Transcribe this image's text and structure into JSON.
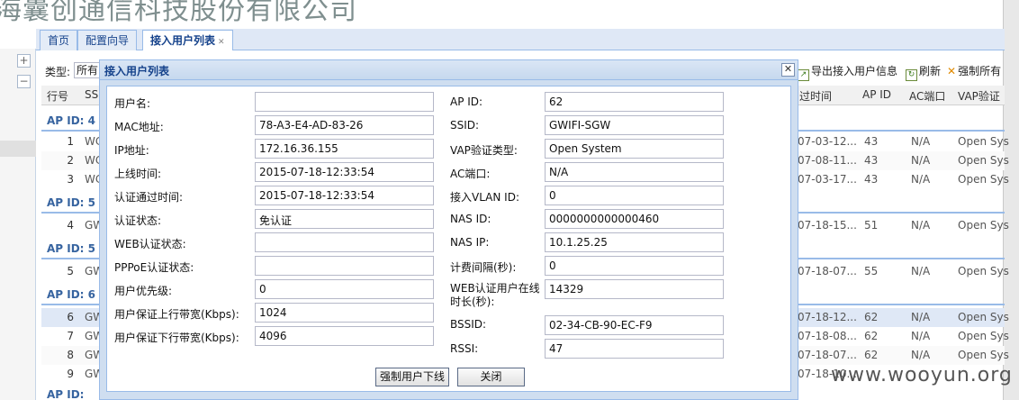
{
  "app_title": "海囊创通信科技股份有限公司",
  "tabs": [
    {
      "label": "首页"
    },
    {
      "label": "配置向导"
    },
    {
      "label": "接入用户列表",
      "close": "✕"
    }
  ],
  "toolbar": {
    "type_label": "类型:",
    "type_value": "所有",
    "export_label": "导出接入用户信息",
    "refresh_label": "刷新",
    "force_label": "强制所有"
  },
  "grid": {
    "headers": [
      "行号",
      "SS",
      "过时间",
      "AP ID",
      "AC端口",
      "VAP验证"
    ],
    "groups": [
      "AP ID: 4",
      "AP ID: 5",
      "AP ID: 5",
      "AP ID: 6",
      "AP ID:"
    ],
    "rows": [
      {
        "num": "1",
        "ssid": "WC",
        "time": "07-03-12...",
        "apid": "43",
        "ac": "N/A",
        "vap": "Open Sys"
      },
      {
        "num": "2",
        "ssid": "WC",
        "time": "07-08-11...",
        "apid": "43",
        "ac": "N/A",
        "vap": "Open Sys"
      },
      {
        "num": "3",
        "ssid": "WC",
        "time": "07-03-17...",
        "apid": "43",
        "ac": "N/A",
        "vap": "Open Sys"
      },
      {
        "num": "4",
        "ssid": "GW",
        "time": "07-18-15...",
        "apid": "51",
        "ac": "N/A",
        "vap": "Open Sys"
      },
      {
        "num": "5",
        "ssid": "GW",
        "time": "07-18-07...",
        "apid": "55",
        "ac": "N/A",
        "vap": "Open Sys"
      },
      {
        "num": "6",
        "ssid": "GW",
        "time": "07-18-12...",
        "apid": "62",
        "ac": "N/A",
        "vap": "Open Sys"
      },
      {
        "num": "7",
        "ssid": "GW",
        "time": "07-18-08...",
        "apid": "62",
        "ac": "N/A",
        "vap": "Open Sys"
      },
      {
        "num": "8",
        "ssid": "GW",
        "time": "07-18-07...",
        "apid": "62",
        "ac": "N/A",
        "vap": "Open Sys"
      },
      {
        "num": "9",
        "ssid": "GW",
        "time": "07-18-10...",
        "apid": "",
        "ac": "",
        "vap": ""
      }
    ]
  },
  "dialog": {
    "title": "接入用户列表",
    "close": "✕",
    "left": [
      {
        "label": "用户名:",
        "value": ""
      },
      {
        "label": "MAC地址:",
        "value": "78-A3-E4-AD-83-26"
      },
      {
        "label": "IP地址:",
        "value": "172.16.36.155"
      },
      {
        "label": "上线时间:",
        "value": "2015-07-18-12:33:54"
      },
      {
        "label": "认证通过时间:",
        "value": "2015-07-18-12:33:54"
      },
      {
        "label": "认证状态:",
        "value": "免认证"
      },
      {
        "label": "WEB认证状态:",
        "value": ""
      },
      {
        "label": "PPPoE认证状态:",
        "value": ""
      },
      {
        "label": "用户优先级:",
        "value": "0"
      },
      {
        "label": "用户保证上行带宽(Kbps):",
        "value": "1024"
      },
      {
        "label": "用户保证下行带宽(Kbps):",
        "value": "4096"
      }
    ],
    "right": [
      {
        "label": "AP ID:",
        "value": "62"
      },
      {
        "label": "SSID:",
        "value": "GWIFI-SGW"
      },
      {
        "label": "VAP验证类型:",
        "value": "Open System"
      },
      {
        "label": "AC端口:",
        "value": "N/A"
      },
      {
        "label": "接入VLAN ID:",
        "value": "0"
      },
      {
        "label": "NAS ID:",
        "value": "0000000000000460"
      },
      {
        "label": "NAS IP:",
        "value": "10.1.25.25"
      },
      {
        "label": "计费间隔(秒):",
        "value": "0"
      },
      {
        "label": "WEB认证用户在线时长(秒):",
        "value": "14329"
      },
      {
        "label": "BSSID:",
        "value": "02-34-CB-90-EC-F9"
      },
      {
        "label": "RSSI:",
        "value": "47"
      }
    ],
    "buttons": {
      "force_offline": "强制用户下线",
      "close": "关闭"
    }
  },
  "watermark": "www.wooyun.org"
}
